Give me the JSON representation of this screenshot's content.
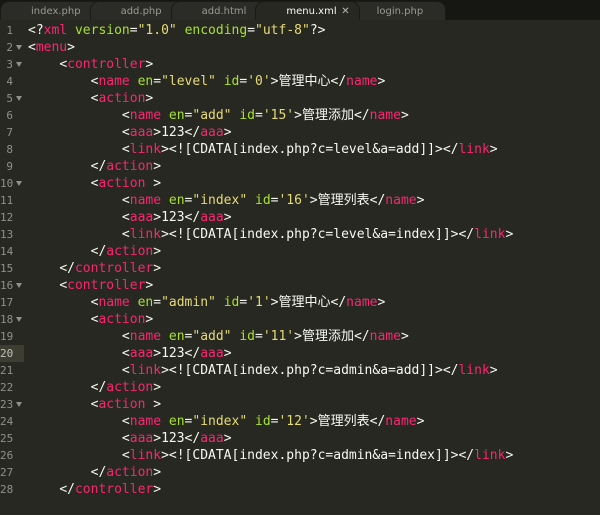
{
  "tabs": [
    {
      "name": "index.php"
    },
    {
      "name": "add.php"
    },
    {
      "name": "add.html"
    },
    {
      "name": "menu.xml",
      "active": true
    },
    {
      "name": "login.php"
    }
  ],
  "colors": {
    "background": "#272822",
    "tag": "#f92672",
    "attr": "#a6e22e",
    "string": "#e6db74",
    "text": "#f8f8f2",
    "gutter": "#90908a"
  },
  "current_line": 20,
  "code_lines": [
    {
      "n": "1",
      "indent": 0,
      "tokens": [
        [
          "p",
          "<?"
        ],
        [
          "t",
          "xml"
        ],
        [
          "x",
          " "
        ],
        [
          "a",
          "version"
        ],
        [
          "p",
          "="
        ],
        [
          "s",
          "\"1.0\""
        ],
        [
          "x",
          " "
        ],
        [
          "a",
          "encoding"
        ],
        [
          "p",
          "="
        ],
        [
          "s",
          "\"utf-8\""
        ],
        [
          "p",
          "?>"
        ]
      ]
    },
    {
      "n": "2",
      "indent": 0,
      "tokens": [
        [
          "p",
          "<"
        ],
        [
          "t",
          "menu"
        ],
        [
          "p",
          ">"
        ]
      ]
    },
    {
      "n": "3",
      "indent": 1,
      "tokens": [
        [
          "p",
          "<"
        ],
        [
          "t",
          "controller"
        ],
        [
          "p",
          ">"
        ]
      ]
    },
    {
      "n": "4",
      "indent": 2,
      "tokens": [
        [
          "p",
          "<"
        ],
        [
          "t",
          "name"
        ],
        [
          "x",
          " "
        ],
        [
          "a",
          "en"
        ],
        [
          "p",
          "="
        ],
        [
          "s",
          "\"level\""
        ],
        [
          "x",
          " "
        ],
        [
          "a",
          "id"
        ],
        [
          "p",
          "="
        ],
        [
          "s",
          "'0'"
        ],
        [
          "p",
          ">"
        ],
        [
          "x",
          "管理中心"
        ],
        [
          "p",
          "</"
        ],
        [
          "t",
          "name"
        ],
        [
          "p",
          ">"
        ]
      ]
    },
    {
      "n": "5",
      "indent": 2,
      "tokens": [
        [
          "p",
          "<"
        ],
        [
          "t",
          "action"
        ],
        [
          "p",
          ">"
        ]
      ]
    },
    {
      "n": "6",
      "indent": 3,
      "tokens": [
        [
          "p",
          "<"
        ],
        [
          "t",
          "name"
        ],
        [
          "x",
          " "
        ],
        [
          "a",
          "en"
        ],
        [
          "p",
          "="
        ],
        [
          "s",
          "\"add\""
        ],
        [
          "x",
          " "
        ],
        [
          "a",
          "id"
        ],
        [
          "p",
          "="
        ],
        [
          "s",
          "'15'"
        ],
        [
          "p",
          ">"
        ],
        [
          "x",
          "管理添加"
        ],
        [
          "p",
          "</"
        ],
        [
          "t",
          "name"
        ],
        [
          "p",
          ">"
        ]
      ]
    },
    {
      "n": "7",
      "indent": 3,
      "tokens": [
        [
          "p",
          "<"
        ],
        [
          "t",
          "aaa"
        ],
        [
          "p",
          ">"
        ],
        [
          "x",
          "123"
        ],
        [
          "p",
          "</"
        ],
        [
          "t",
          "aaa"
        ],
        [
          "p",
          ">"
        ]
      ]
    },
    {
      "n": "8",
      "indent": 3,
      "tokens": [
        [
          "p",
          "<"
        ],
        [
          "t",
          "link"
        ],
        [
          "p",
          ">"
        ],
        [
          "x",
          "<![CDATA[index.php?c=level&a=add]]>"
        ],
        [
          "p",
          "</"
        ],
        [
          "t",
          "link"
        ],
        [
          "p",
          ">"
        ]
      ]
    },
    {
      "n": "9",
      "indent": 2,
      "tokens": [
        [
          "p",
          "</"
        ],
        [
          "t",
          "action"
        ],
        [
          "p",
          ">"
        ]
      ]
    },
    {
      "n": "10",
      "indent": 2,
      "tokens": [
        [
          "p",
          "<"
        ],
        [
          "t",
          "action"
        ],
        [
          "x",
          " "
        ],
        [
          "p",
          ">"
        ]
      ]
    },
    {
      "n": "11",
      "indent": 3,
      "tokens": [
        [
          "p",
          "<"
        ],
        [
          "t",
          "name"
        ],
        [
          "x",
          " "
        ],
        [
          "a",
          "en"
        ],
        [
          "p",
          "="
        ],
        [
          "s",
          "\"index\""
        ],
        [
          "x",
          " "
        ],
        [
          "a",
          "id"
        ],
        [
          "p",
          "="
        ],
        [
          "s",
          "'16'"
        ],
        [
          "p",
          ">"
        ],
        [
          "x",
          "管理列表"
        ],
        [
          "p",
          "</"
        ],
        [
          "t",
          "name"
        ],
        [
          "p",
          ">"
        ]
      ]
    },
    {
      "n": "12",
      "indent": 3,
      "tokens": [
        [
          "p",
          "<"
        ],
        [
          "t",
          "aaa"
        ],
        [
          "p",
          ">"
        ],
        [
          "x",
          "123"
        ],
        [
          "p",
          "</"
        ],
        [
          "t",
          "aaa"
        ],
        [
          "p",
          ">"
        ]
      ]
    },
    {
      "n": "13",
      "indent": 3,
      "tokens": [
        [
          "p",
          "<"
        ],
        [
          "t",
          "link"
        ],
        [
          "p",
          ">"
        ],
        [
          "x",
          "<![CDATA[index.php?c=level&a=index]]>"
        ],
        [
          "p",
          "</"
        ],
        [
          "t",
          "link"
        ],
        [
          "p",
          ">"
        ]
      ]
    },
    {
      "n": "14",
      "indent": 2,
      "tokens": [
        [
          "p",
          "</"
        ],
        [
          "t",
          "action"
        ],
        [
          "p",
          ">"
        ]
      ]
    },
    {
      "n": "15",
      "indent": 1,
      "tokens": [
        [
          "p",
          "</"
        ],
        [
          "t",
          "controller"
        ],
        [
          "p",
          ">"
        ]
      ]
    },
    {
      "n": "16",
      "indent": 1,
      "tokens": [
        [
          "p",
          "<"
        ],
        [
          "t",
          "controller"
        ],
        [
          "p",
          ">"
        ]
      ]
    },
    {
      "n": "17",
      "indent": 2,
      "tokens": [
        [
          "p",
          "<"
        ],
        [
          "t",
          "name"
        ],
        [
          "x",
          " "
        ],
        [
          "a",
          "en"
        ],
        [
          "p",
          "="
        ],
        [
          "s",
          "\"admin\""
        ],
        [
          "x",
          " "
        ],
        [
          "a",
          "id"
        ],
        [
          "p",
          "="
        ],
        [
          "s",
          "'1'"
        ],
        [
          "p",
          ">"
        ],
        [
          "x",
          "管理中心"
        ],
        [
          "p",
          "</"
        ],
        [
          "t",
          "name"
        ],
        [
          "p",
          ">"
        ]
      ]
    },
    {
      "n": "18",
      "indent": 2,
      "tokens": [
        [
          "p",
          "<"
        ],
        [
          "t",
          "action"
        ],
        [
          "p",
          ">"
        ]
      ]
    },
    {
      "n": "19",
      "indent": 3,
      "tokens": [
        [
          "p",
          "<"
        ],
        [
          "t",
          "name"
        ],
        [
          "x",
          " "
        ],
        [
          "a",
          "en"
        ],
        [
          "p",
          "="
        ],
        [
          "s",
          "\"add\""
        ],
        [
          "x",
          " "
        ],
        [
          "a",
          "id"
        ],
        [
          "p",
          "="
        ],
        [
          "s",
          "'11'"
        ],
        [
          "p",
          ">"
        ],
        [
          "x",
          "管理添加"
        ],
        [
          "p",
          "</"
        ],
        [
          "t",
          "name"
        ],
        [
          "p",
          ">"
        ]
      ]
    },
    {
      "n": "20",
      "indent": 3,
      "tokens": [
        [
          "p",
          "<"
        ],
        [
          "t",
          "aaa"
        ],
        [
          "p",
          ">"
        ],
        [
          "x",
          "123"
        ],
        [
          "p",
          "</"
        ],
        [
          "t",
          "aaa"
        ],
        [
          "p",
          ">"
        ]
      ]
    },
    {
      "n": "21",
      "indent": 3,
      "tokens": [
        [
          "p",
          "<"
        ],
        [
          "t",
          "link"
        ],
        [
          "p",
          ">"
        ],
        [
          "x",
          "<![CDATA[index.php?c=admin&a=add]]>"
        ],
        [
          "p",
          "</"
        ],
        [
          "t",
          "link"
        ],
        [
          "p",
          ">"
        ]
      ]
    },
    {
      "n": "22",
      "indent": 2,
      "tokens": [
        [
          "p",
          "</"
        ],
        [
          "t",
          "action"
        ],
        [
          "p",
          ">"
        ]
      ]
    },
    {
      "n": "23",
      "indent": 2,
      "tokens": [
        [
          "p",
          "<"
        ],
        [
          "t",
          "action"
        ],
        [
          "x",
          " "
        ],
        [
          "p",
          ">"
        ]
      ]
    },
    {
      "n": "24",
      "indent": 3,
      "tokens": [
        [
          "p",
          "<"
        ],
        [
          "t",
          "name"
        ],
        [
          "x",
          " "
        ],
        [
          "a",
          "en"
        ],
        [
          "p",
          "="
        ],
        [
          "s",
          "\"index\""
        ],
        [
          "x",
          " "
        ],
        [
          "a",
          "id"
        ],
        [
          "p",
          "="
        ],
        [
          "s",
          "'12'"
        ],
        [
          "p",
          ">"
        ],
        [
          "x",
          "管理列表"
        ],
        [
          "p",
          "</"
        ],
        [
          "t",
          "name"
        ],
        [
          "p",
          ">"
        ]
      ]
    },
    {
      "n": "25",
      "indent": 3,
      "tokens": [
        [
          "p",
          "<"
        ],
        [
          "t",
          "aaa"
        ],
        [
          "p",
          ">"
        ],
        [
          "x",
          "123"
        ],
        [
          "p",
          "</"
        ],
        [
          "t",
          "aaa"
        ],
        [
          "p",
          ">"
        ]
      ]
    },
    {
      "n": "26",
      "indent": 3,
      "tokens": [
        [
          "p",
          "<"
        ],
        [
          "t",
          "link"
        ],
        [
          "p",
          ">"
        ],
        [
          "x",
          "<![CDATA[index.php?c=admin&a=index]]>"
        ],
        [
          "p",
          "</"
        ],
        [
          "t",
          "link"
        ],
        [
          "p",
          ">"
        ]
      ]
    },
    {
      "n": "27",
      "indent": 2,
      "tokens": [
        [
          "p",
          "</"
        ],
        [
          "t",
          "action"
        ],
        [
          "p",
          ">"
        ]
      ]
    },
    {
      "n": "28",
      "indent": 1,
      "tokens": [
        [
          "p",
          "</"
        ],
        [
          "t",
          "controller"
        ],
        [
          "p",
          ">"
        ]
      ]
    }
  ],
  "folds": [
    "2",
    "3",
    "5",
    "10",
    "16",
    "18",
    "23"
  ]
}
